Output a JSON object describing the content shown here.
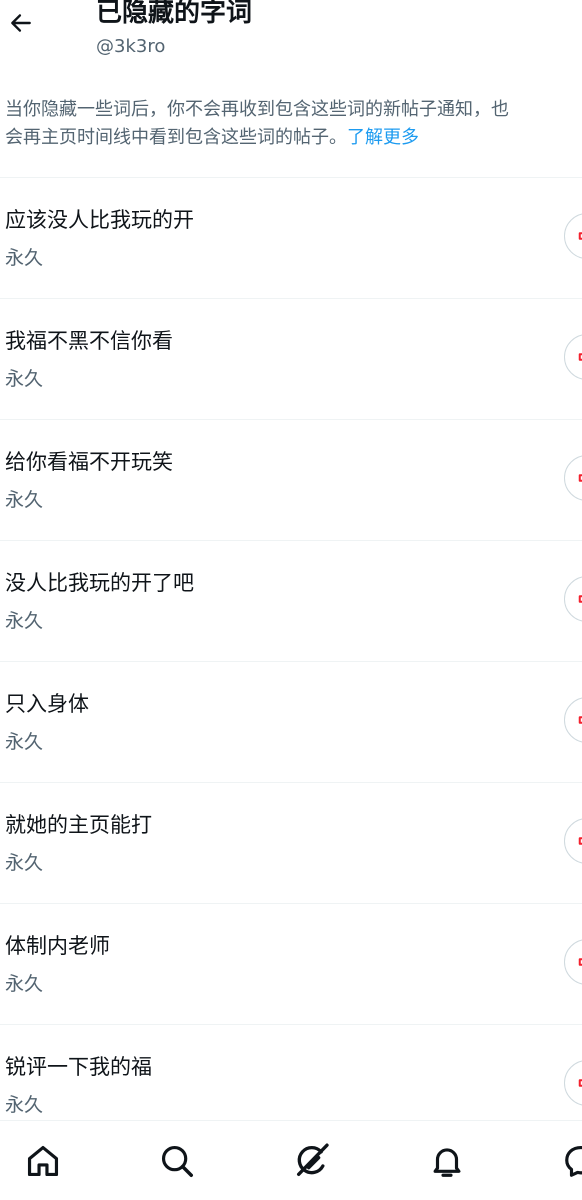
{
  "header": {
    "title": "已隐藏的字词",
    "handle": "@3k3ro",
    "back_icon": "arrow-left-icon"
  },
  "description": {
    "line1": "当你隐藏一些词后，你不会再收到包含这些词的新帖子通知，也",
    "line2": "会再主页时间线中看到包含这些词的帖子。",
    "link": "了解更多",
    "link_color": "#1d9bf0"
  },
  "muted_words": [
    {
      "word": "应该没人比我玩的开",
      "duration": "永久"
    },
    {
      "word": "我福不黑不信你看",
      "duration": "永久"
    },
    {
      "word": "给你看福不开玩笑",
      "duration": "永久"
    },
    {
      "word": "没人比我玩的开了吧",
      "duration": "永久"
    },
    {
      "word": "只入身体",
      "duration": "永久"
    },
    {
      "word": "就她的主页能打",
      "duration": "永久"
    },
    {
      "word": "体制内老师",
      "duration": "永久"
    },
    {
      "word": "锐评一下我的福",
      "duration": "永久"
    }
  ],
  "unmute_icon": "speaker-mute-icon",
  "unmute_color": "#f4212e",
  "tabs": [
    {
      "name": "home",
      "icon": "home-icon"
    },
    {
      "name": "search",
      "icon": "search-icon"
    },
    {
      "name": "grok",
      "icon": "grok-icon"
    },
    {
      "name": "notifications",
      "icon": "bell-icon"
    },
    {
      "name": "messages",
      "icon": "message-icon"
    }
  ]
}
